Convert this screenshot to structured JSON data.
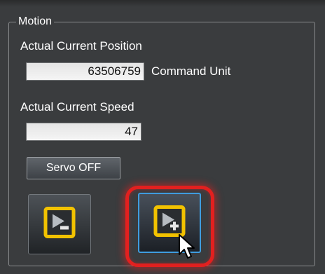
{
  "motion_group": {
    "title": "Motion",
    "position": {
      "label": "Actual Current Position",
      "value": "63506759",
      "unit": "Command Unit"
    },
    "speed": {
      "label": "Actual Current Speed",
      "value": "47"
    },
    "servo_button_label": "Servo OFF",
    "jog_buttons": [
      {
        "name": "jog-reverse",
        "icon": "jog-minus-icon"
      },
      {
        "name": "jog-forward",
        "icon": "jog-plus-icon",
        "state": "hover"
      }
    ]
  },
  "colors": {
    "panel_bg": "#3a3c3e",
    "icon_accent": "#f2c200",
    "highlight": "#e2201f",
    "hover_border": "#3f9de0"
  }
}
